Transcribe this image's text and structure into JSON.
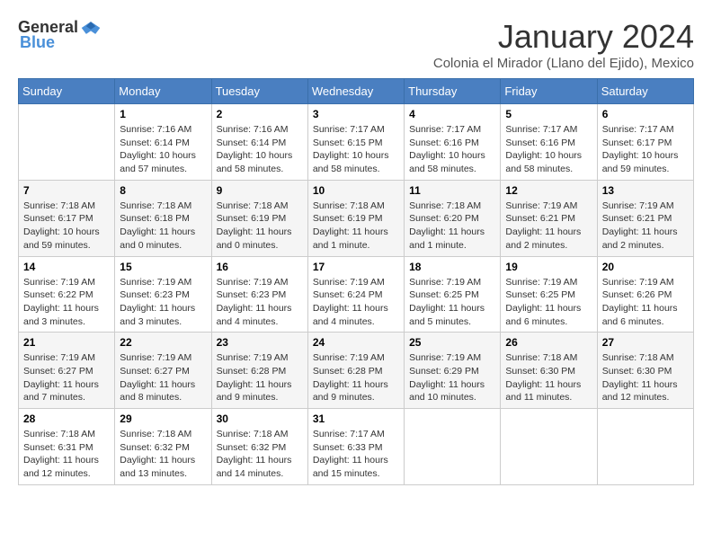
{
  "logo": {
    "general": "General",
    "blue": "Blue"
  },
  "title": "January 2024",
  "location": "Colonia el Mirador (Llano del Ejido), Mexico",
  "days_header": [
    "Sunday",
    "Monday",
    "Tuesday",
    "Wednesday",
    "Thursday",
    "Friday",
    "Saturday"
  ],
  "weeks": [
    [
      {
        "day": "",
        "info": ""
      },
      {
        "day": "1",
        "info": "Sunrise: 7:16 AM\nSunset: 6:14 PM\nDaylight: 10 hours\nand 57 minutes."
      },
      {
        "day": "2",
        "info": "Sunrise: 7:16 AM\nSunset: 6:14 PM\nDaylight: 10 hours\nand 58 minutes."
      },
      {
        "day": "3",
        "info": "Sunrise: 7:17 AM\nSunset: 6:15 PM\nDaylight: 10 hours\nand 58 minutes."
      },
      {
        "day": "4",
        "info": "Sunrise: 7:17 AM\nSunset: 6:16 PM\nDaylight: 10 hours\nand 58 minutes."
      },
      {
        "day": "5",
        "info": "Sunrise: 7:17 AM\nSunset: 6:16 PM\nDaylight: 10 hours\nand 58 minutes."
      },
      {
        "day": "6",
        "info": "Sunrise: 7:17 AM\nSunset: 6:17 PM\nDaylight: 10 hours\nand 59 minutes."
      }
    ],
    [
      {
        "day": "7",
        "info": "Sunrise: 7:18 AM\nSunset: 6:17 PM\nDaylight: 10 hours\nand 59 minutes."
      },
      {
        "day": "8",
        "info": "Sunrise: 7:18 AM\nSunset: 6:18 PM\nDaylight: 11 hours\nand 0 minutes."
      },
      {
        "day": "9",
        "info": "Sunrise: 7:18 AM\nSunset: 6:19 PM\nDaylight: 11 hours\nand 0 minutes."
      },
      {
        "day": "10",
        "info": "Sunrise: 7:18 AM\nSunset: 6:19 PM\nDaylight: 11 hours\nand 1 minute."
      },
      {
        "day": "11",
        "info": "Sunrise: 7:18 AM\nSunset: 6:20 PM\nDaylight: 11 hours\nand 1 minute."
      },
      {
        "day": "12",
        "info": "Sunrise: 7:19 AM\nSunset: 6:21 PM\nDaylight: 11 hours\nand 2 minutes."
      },
      {
        "day": "13",
        "info": "Sunrise: 7:19 AM\nSunset: 6:21 PM\nDaylight: 11 hours\nand 2 minutes."
      }
    ],
    [
      {
        "day": "14",
        "info": "Sunrise: 7:19 AM\nSunset: 6:22 PM\nDaylight: 11 hours\nand 3 minutes."
      },
      {
        "day": "15",
        "info": "Sunrise: 7:19 AM\nSunset: 6:23 PM\nDaylight: 11 hours\nand 3 minutes."
      },
      {
        "day": "16",
        "info": "Sunrise: 7:19 AM\nSunset: 6:23 PM\nDaylight: 11 hours\nand 4 minutes."
      },
      {
        "day": "17",
        "info": "Sunrise: 7:19 AM\nSunset: 6:24 PM\nDaylight: 11 hours\nand 4 minutes."
      },
      {
        "day": "18",
        "info": "Sunrise: 7:19 AM\nSunset: 6:25 PM\nDaylight: 11 hours\nand 5 minutes."
      },
      {
        "day": "19",
        "info": "Sunrise: 7:19 AM\nSunset: 6:25 PM\nDaylight: 11 hours\nand 6 minutes."
      },
      {
        "day": "20",
        "info": "Sunrise: 7:19 AM\nSunset: 6:26 PM\nDaylight: 11 hours\nand 6 minutes."
      }
    ],
    [
      {
        "day": "21",
        "info": "Sunrise: 7:19 AM\nSunset: 6:27 PM\nDaylight: 11 hours\nand 7 minutes."
      },
      {
        "day": "22",
        "info": "Sunrise: 7:19 AM\nSunset: 6:27 PM\nDaylight: 11 hours\nand 8 minutes."
      },
      {
        "day": "23",
        "info": "Sunrise: 7:19 AM\nSunset: 6:28 PM\nDaylight: 11 hours\nand 9 minutes."
      },
      {
        "day": "24",
        "info": "Sunrise: 7:19 AM\nSunset: 6:28 PM\nDaylight: 11 hours\nand 9 minutes."
      },
      {
        "day": "25",
        "info": "Sunrise: 7:19 AM\nSunset: 6:29 PM\nDaylight: 11 hours\nand 10 minutes."
      },
      {
        "day": "26",
        "info": "Sunrise: 7:18 AM\nSunset: 6:30 PM\nDaylight: 11 hours\nand 11 minutes."
      },
      {
        "day": "27",
        "info": "Sunrise: 7:18 AM\nSunset: 6:30 PM\nDaylight: 11 hours\nand 12 minutes."
      }
    ],
    [
      {
        "day": "28",
        "info": "Sunrise: 7:18 AM\nSunset: 6:31 PM\nDaylight: 11 hours\nand 12 minutes."
      },
      {
        "day": "29",
        "info": "Sunrise: 7:18 AM\nSunset: 6:32 PM\nDaylight: 11 hours\nand 13 minutes."
      },
      {
        "day": "30",
        "info": "Sunrise: 7:18 AM\nSunset: 6:32 PM\nDaylight: 11 hours\nand 14 minutes."
      },
      {
        "day": "31",
        "info": "Sunrise: 7:17 AM\nSunset: 6:33 PM\nDaylight: 11 hours\nand 15 minutes."
      },
      {
        "day": "",
        "info": ""
      },
      {
        "day": "",
        "info": ""
      },
      {
        "day": "",
        "info": ""
      }
    ]
  ]
}
